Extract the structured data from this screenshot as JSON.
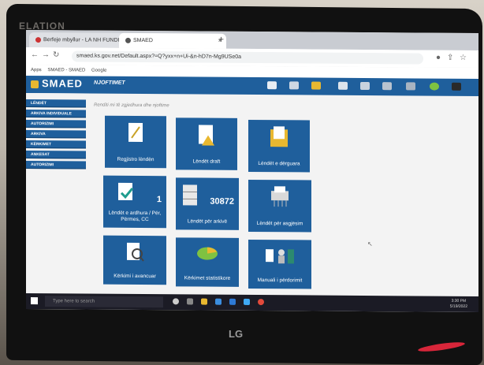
{
  "monitor": {
    "brand_top": "ELATION",
    "brand_bottom": "LG"
  },
  "browser": {
    "tabs": [
      {
        "label": "Berfeje mbyllur - LA NH FUNDIT",
        "close": "×"
      },
      {
        "label": "SMAED",
        "close": "×"
      }
    ],
    "new_tab": "+",
    "url": "smaed.ks.gov.net/Default.aspx?=Q?yxx+n+Ui-&n-hD7n-Mg9USe0a",
    "bookmarks": [
      "Apps",
      "SMAED - SMAED",
      "Google"
    ]
  },
  "app": {
    "logo": "SMAED",
    "module": "NJOFTIMET",
    "breadcrumb": "Renditi mi të zgjedhura dhe njoftime",
    "sidebar": [
      {
        "label": "LËNDËT"
      },
      {
        "label": "ARKIVA INDIVIDUALE"
      },
      {
        "label": "AUTORIZIMI"
      },
      {
        "label": "ARKIVA"
      },
      {
        "label": "KËRKIMET"
      },
      {
        "label": "ANKESAT"
      },
      {
        "label": "AUTORIZIMI"
      }
    ],
    "tiles": [
      {
        "label": "Regjistro lëndën",
        "icon": "register-document-icon",
        "count": ""
      },
      {
        "label": "Lëndët draft",
        "icon": "draft-warning-icon",
        "count": ""
      },
      {
        "label": "Lëndët e dërguara",
        "icon": "sent-folder-icon",
        "count": ""
      },
      {
        "label": "Lëndët e ardhura / Për, Përmes, CC",
        "icon": "incoming-document-icon",
        "count": "1"
      },
      {
        "label": "Lëndët për arkivë",
        "icon": "archive-cabinet-icon",
        "count": "30872"
      },
      {
        "label": "Lëndët për asgjësim",
        "icon": "shredder-icon",
        "count": ""
      },
      {
        "label": "Kërkimi i avancuar",
        "icon": "search-magnifier-icon",
        "count": ""
      },
      {
        "label": "Kërkimet statistikore",
        "icon": "pie-chart-icon",
        "count": ""
      },
      {
        "label": "Manuali i përdorimit",
        "icon": "manual-book-icon",
        "count": ""
      }
    ]
  },
  "taskbar": {
    "search_placeholder": "Type here to search",
    "time": "3:30 PM",
    "date": "5/19/2022"
  },
  "colors": {
    "primary": "#1f5f9c",
    "accent": "#e9b830"
  }
}
